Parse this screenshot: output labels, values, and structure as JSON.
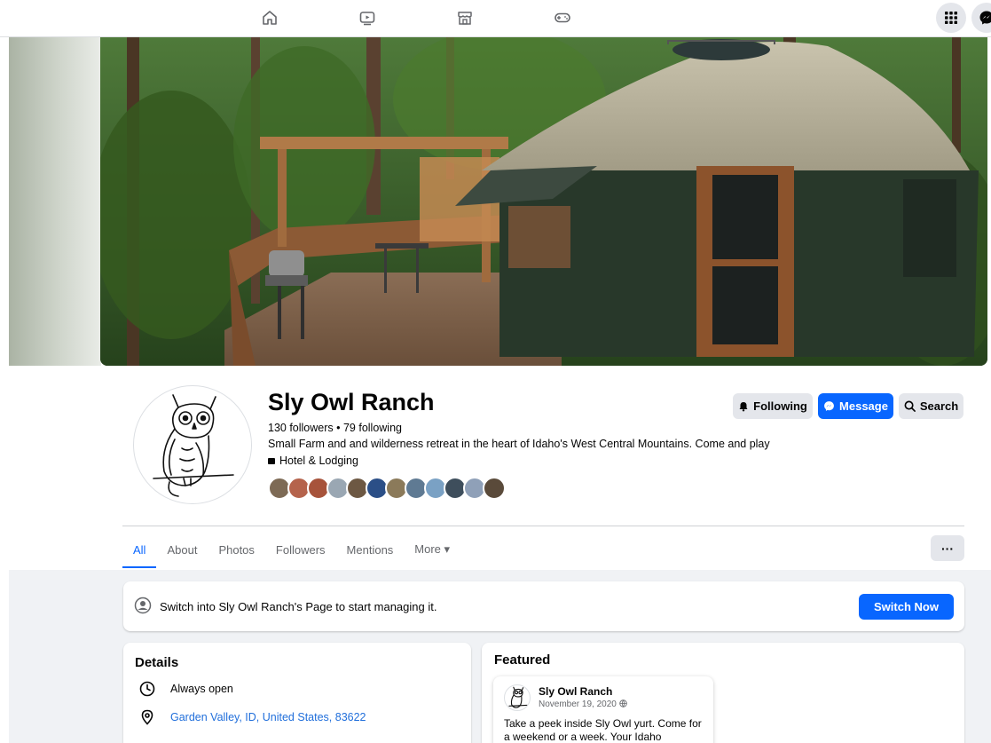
{
  "nav": {
    "icons": [
      "home-icon",
      "video-icon",
      "marketplace-icon",
      "gaming-icon"
    ],
    "right_icons": [
      "apps-grid-icon",
      "messenger-icon"
    ]
  },
  "page": {
    "name": "Sly Owl Ranch",
    "followers_line": "130 followers • 79 following",
    "bio": "Small Farm and and wilderness retreat in the heart of Idaho's West Central Mountains. Come and play",
    "category": "Hotel & Lodging",
    "mutual_friend_count": 12
  },
  "actions": {
    "following_label": "Following",
    "message_label": "Message",
    "search_label": "Search"
  },
  "tabs": [
    "All",
    "About",
    "Photos",
    "Followers",
    "Mentions",
    "More ▾"
  ],
  "more_options": "···",
  "switch": {
    "text": "Switch into Sly Owl Ranch's Page to start managing it.",
    "button_label": "Switch Now"
  },
  "details": {
    "title": "Details",
    "hours": "Always open",
    "location": "Garden Valley, ID, United States, 83622"
  },
  "featured": {
    "title": "Featured",
    "post": {
      "author": "Sly Owl Ranch",
      "date": "November 19, 2020",
      "text": "Take a peek inside Sly Owl yurt. Come for a weekend or a week. Your Idaho"
    }
  },
  "colors": {
    "accent": "#0866ff",
    "link": "#216fdb",
    "background": "#f0f2f5"
  }
}
